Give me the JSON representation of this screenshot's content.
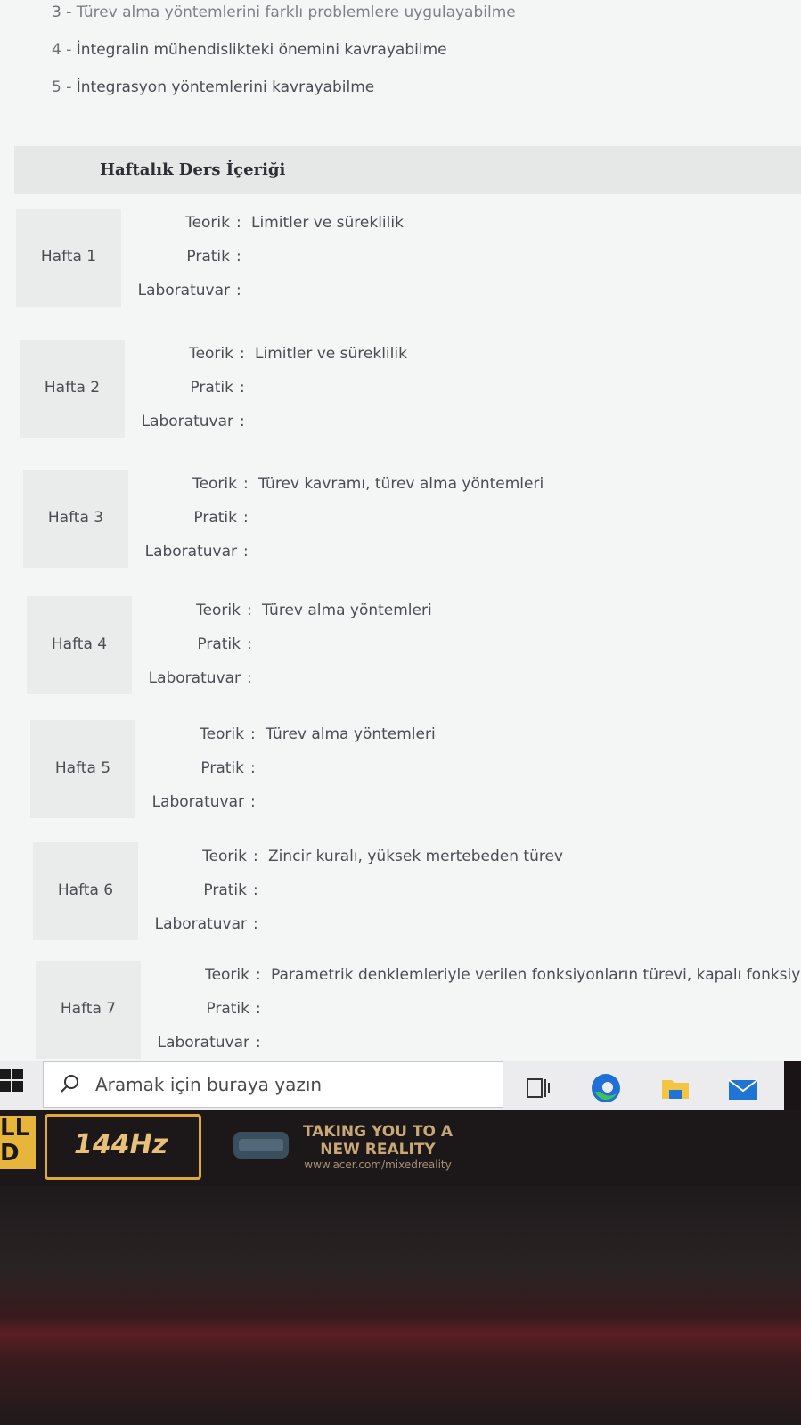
{
  "objectives": [
    {
      "num": "3 -",
      "text": "Türev alma yöntemlerini farklı problemlere uygulayabilme"
    },
    {
      "num": "4 -",
      "text": "İntegralin mühendislikteki önemini kavrayabilme"
    },
    {
      "num": "5 -",
      "text": "İntegrasyon yöntemlerini kavrayabilme"
    }
  ],
  "section": {
    "title": "Haftalık Ders İçeriği"
  },
  "field_labels": {
    "teorik": "Teorik",
    "pratik": "Pratik",
    "laboratuvar": "Laboratuvar",
    "colon": ":"
  },
  "weeks": [
    {
      "label": "Hafta 1",
      "teorik": "Limitler ve süreklilik",
      "pratik": "",
      "laboratuvar": ""
    },
    {
      "label": "Hafta 2",
      "teorik": "Limitler ve süreklilik",
      "pratik": "",
      "laboratuvar": ""
    },
    {
      "label": "Hafta 3",
      "teorik": "Türev kavramı, türev alma yöntemleri",
      "pratik": "",
      "laboratuvar": ""
    },
    {
      "label": "Hafta 4",
      "teorik": "Türev alma yöntemleri",
      "pratik": "",
      "laboratuvar": ""
    },
    {
      "label": "Hafta 5",
      "teorik": "Türev alma yöntemleri",
      "pratik": "",
      "laboratuvar": ""
    },
    {
      "label": "Hafta 6",
      "teorik": "Zincir kuralı, yüksek mertebeden türev",
      "pratik": "",
      "laboratuvar": ""
    },
    {
      "label": "Hafta 7",
      "teorik": "Parametrik denklemleriyle verilen fonksiyonların türevi, kapalı fonksiyonla",
      "pratik": "",
      "laboratuvar": ""
    }
  ],
  "taskbar": {
    "search_placeholder": "Aramak için buraya yazın",
    "icons": [
      "windows-start-icon",
      "search-icon",
      "task-view-icon",
      "edge-icon",
      "file-explorer-icon",
      "mail-icon"
    ]
  },
  "bezel": {
    "fhd_badge": "LL D",
    "refresh_badge": "144Hz",
    "mr_line1": "TAKING YOU TO A",
    "mr_line2": "NEW REALITY",
    "mr_url": "www.acer.com/mixedreality"
  },
  "colors": {
    "accent_edge": "#1f6fd6",
    "edge_green": "#3fbf5f",
    "folder_yellow": "#f4c542",
    "mail_blue": "#1f75d6"
  }
}
